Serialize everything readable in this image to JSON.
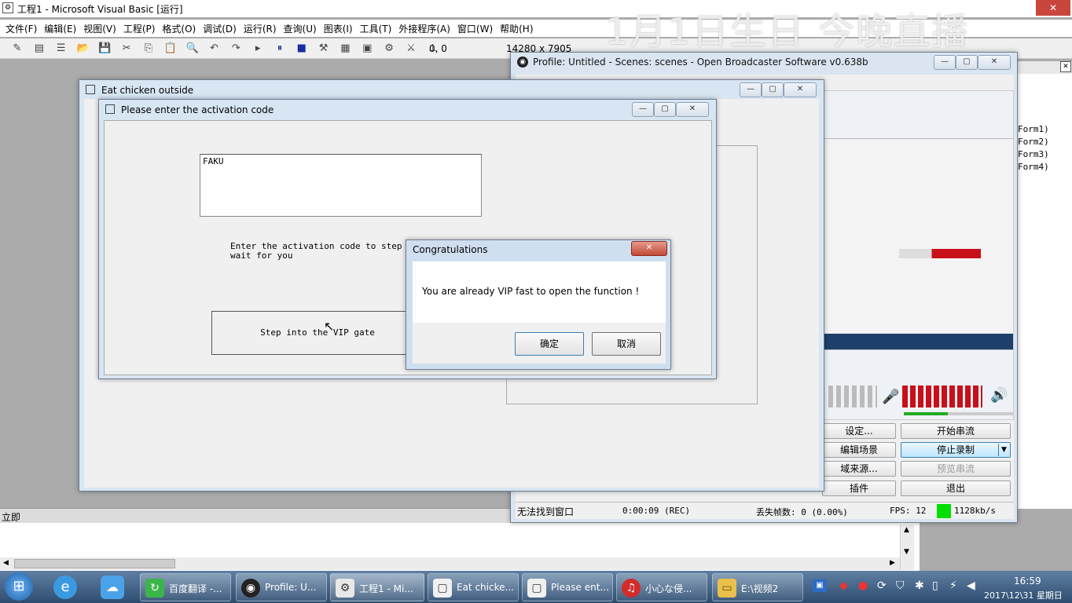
{
  "vb": {
    "title": "工程1 - Microsoft Visual Basic [运行]",
    "menus": [
      "文件(F)",
      "编辑(E)",
      "视图(V)",
      "工程(P)",
      "格式(O)",
      "调试(D)",
      "运行(R)",
      "查询(U)",
      "图表(I)",
      "工具(T)",
      "外接程序(A)",
      "窗口(W)",
      "帮助(H)"
    ],
    "coords": "0, 0",
    "size": "14280 x 7905",
    "immediate_label": "立即",
    "forms": [
      "Form1)",
      "Form2)",
      "Form3)",
      "Form4)"
    ]
  },
  "overlay_text": "1月1日生日 今晚直播",
  "outer_window": {
    "title": "Eat chicken outside"
  },
  "activation_window": {
    "title": "Please enter the activation code",
    "code_value": "FAKU",
    "instruction": "Enter the activation code to step into\nwait for you",
    "button": "Step into the VIP gate"
  },
  "dialog": {
    "title": "Congratulations",
    "message": "You are already VIP fast to open the function !",
    "ok": "确定",
    "cancel": "取消"
  },
  "obs": {
    "title": "Profile: Untitled - Scenes: scenes - Open Broadcaster Software v0.638b",
    "buttons_left": [
      "设定...",
      "编辑场景",
      "域来源...",
      "插件"
    ],
    "buttons_right": [
      "开始串流",
      "停止录制",
      "预览串流",
      "退出"
    ],
    "status": {
      "window": "无法找到窗口",
      "time": "0:00:09 (REC)",
      "dropped": "丢失帧数: 0 (0.00%)",
      "fps": "FPS: 12",
      "bitrate": "1128kb/s"
    },
    "accent_color": "#c8101a",
    "status_green": "#00e000"
  },
  "taskbar": {
    "items": [
      {
        "label": "百度翻译 -...",
        "icon": "baidu-translate-icon"
      },
      {
        "label": "Profile: U...",
        "icon": "obs-icon"
      },
      {
        "label": "工程1 - Mi...",
        "icon": "vb-icon"
      },
      {
        "label": "Eat chicke...",
        "icon": "form-icon"
      },
      {
        "label": "Please ent...",
        "icon": "form-icon"
      },
      {
        "label": "小心な侵...",
        "icon": "netease-music-icon"
      },
      {
        "label": "E:\\视频2",
        "icon": "folder-icon"
      }
    ],
    "time": "16:59",
    "date": "2017\\12\\31 星期日"
  }
}
